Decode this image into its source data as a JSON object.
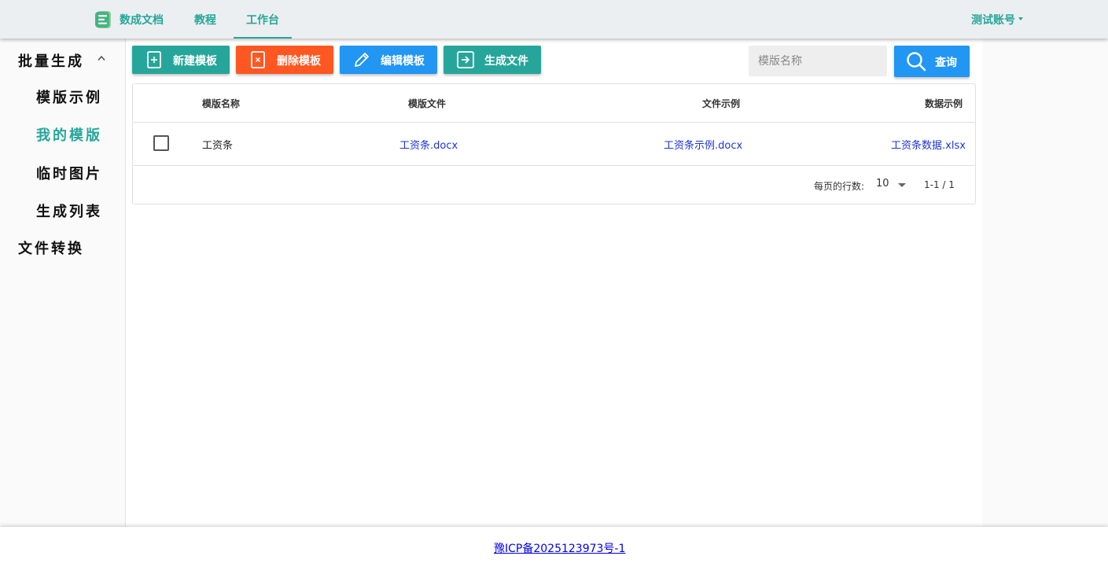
{
  "header": {
    "brand": "数成文档",
    "tabs": [
      {
        "label": "教程"
      },
      {
        "label": "工作台"
      }
    ],
    "account": "测试账号"
  },
  "sidebar": {
    "groups": [
      {
        "label": "批量生成",
        "expanded": true,
        "items": [
          {
            "label": "模版示例"
          },
          {
            "label": "我的模版",
            "active": true
          },
          {
            "label": "临时图片"
          },
          {
            "label": "生成列表"
          }
        ]
      },
      {
        "label": "文件转换"
      }
    ]
  },
  "toolbar": {
    "new_label": "新建模板",
    "delete_label": "删除模板",
    "edit_label": "编辑模板",
    "generate_label": "生成文件",
    "search_placeholder": "模版名称",
    "search_value": "",
    "query_label": "查询"
  },
  "table": {
    "columns": [
      "模版名称",
      "模版文件",
      "文件示例",
      "数据示例"
    ],
    "rows": [
      {
        "name": "工资条",
        "template_file": "工资条.docx",
        "file_example": "工资条示例.docx",
        "data_example": "工资条数据.xlsx"
      }
    ],
    "pager": {
      "rows_per_page_label": "每页的行数:",
      "rows_per_page": "10",
      "range": "1-1 / 1"
    }
  },
  "footer": {
    "icp": "豫ICP备2025123973号-1"
  },
  "colors": {
    "accent": "#26a69a",
    "danger": "#ff5722",
    "primary": "#2196f3",
    "link": "#1a35d6"
  }
}
